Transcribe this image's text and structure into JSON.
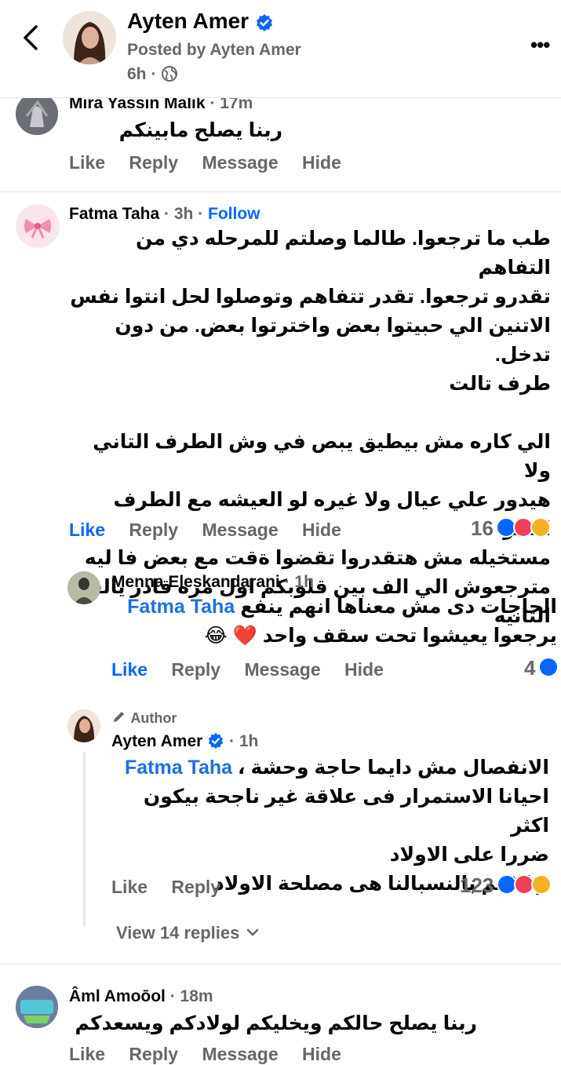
{
  "header": {
    "name": "Ayten Amer",
    "posted_by": "Posted by Ayten Amer",
    "time": "6h ·",
    "more": "•••"
  },
  "comments": [
    {
      "name": "Mira Yassin Malik",
      "meta": " · 17m",
      "text": "ربنا يصلح مابينكم",
      "actions": [
        "Like",
        "Reply",
        "Message",
        "Hide"
      ]
    },
    {
      "name": "Fatma Taha",
      "meta": " · 3h · ",
      "follow": "Follow",
      "text_lines": [
        "طب ما ترجعوا. طالما وصلتم للمرحله دي من التفاهم",
        "تقدرو ترجعوا. تقدر تتفاهم وتوصلوا لحل انتوا نفس",
        "الاتنين الي حبيتوا بعض واخترتوا بعض. من دون تدخل.",
        "طرف تالت",
        "",
        "الي كاره مش بيطيق يبص في وش الطرف التاني  ولا",
        "هيدور علي عيال ولا غيره لو العيشه مع الطرف الاخر",
        "مستخيله مش هتقدروا تقضوا ةقت مع بعض فا ليه",
        "مترجعوش الي الف بين قلوبكم اول مره قادر يالف",
        "التانيه"
      ],
      "actions": [
        "Like",
        "Reply",
        "Message",
        "Hide"
      ],
      "reactions": "16"
    },
    {
      "name": "Menna Eleskandarani",
      "meta": " · 1h",
      "mention": "Fatma Taha",
      "text_line1": " الحاجات دى مش معناها انهم ينفع",
      "text_line2": "يرجعوا يعيشوا تحت سقف واحد",
      "emoji": "❤️ 😂",
      "actions": [
        "Like",
        "Reply",
        "Message",
        "Hide"
      ],
      "reactions": "4"
    },
    {
      "badge": "Author",
      "name": "Ayten Amer",
      "meta": " · 1h",
      "mention": "Fatma Taha",
      "text_line1": " الانفصال مش دايما حاجة وحشة ،",
      "text_lines": [
        "احيانا  الاستمرار فى علاقة غير ناجحة بيكون اكثر",
        "ضررا على الاولاد",
        "و الاهم  بالنسبالنا هى مصلحة الاولاد"
      ],
      "actions": [
        "Like",
        "Reply"
      ],
      "reactions": "123"
    },
    {
      "view_replies": "View 14 replies"
    },
    {
      "name": "Âml Amoōol",
      "meta": " · 18m",
      "text": "ربنا يصلح حالكم ويخليكم لولادكم ويسعدكم",
      "actions": [
        "Like",
        "Reply",
        "Message",
        "Hide"
      ]
    }
  ],
  "colors": {
    "accent": "#0866ff",
    "meta": "#65676b",
    "love": "#f33e58",
    "care": "#f7b125"
  }
}
